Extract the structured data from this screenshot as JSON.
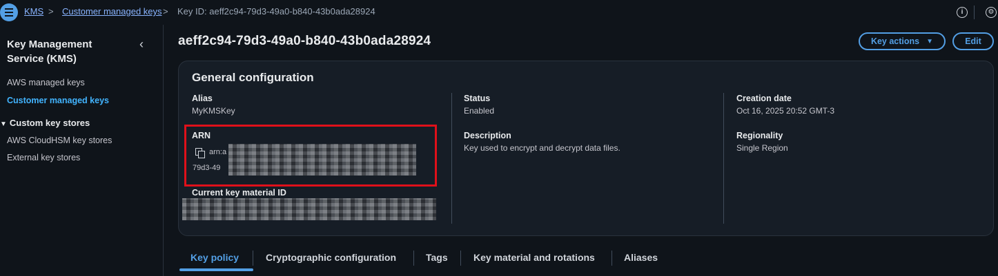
{
  "breadcrumb": {
    "home": "KMS",
    "section": "Customer managed keys",
    "current": "Key ID: aeff2c94-79d3-49a0-b840-43b0ada28924",
    "separator": ">"
  },
  "top_icons": {
    "info": "i",
    "settings": "⚙"
  },
  "sidebar": {
    "title": "Key Management Service (KMS)",
    "collapse_icon": "‹",
    "items": [
      {
        "label": "AWS managed keys"
      },
      {
        "label": "Customer managed keys"
      }
    ],
    "section": {
      "label": "Custom key stores",
      "caret": "▼"
    },
    "section_items": [
      {
        "label": "AWS CloudHSM key stores"
      },
      {
        "label": "External key stores"
      }
    ]
  },
  "page": {
    "title": "aeff2c94-79d3-49a0-b840-43b0ada28924",
    "key_actions_label": "Key actions",
    "key_actions_caret": "▼",
    "edit_label": "Edit"
  },
  "general_config": {
    "title": "General configuration",
    "alias_label": "Alias",
    "alias_value": "MyKMSKey",
    "arn_label": "ARN",
    "arn_prefix": "arn:a",
    "arn_line2_prefix": "79d3-49",
    "current_key_material_label": "Current key material ID",
    "status_label": "Status",
    "status_value": "Enabled",
    "description_label": "Description",
    "description_value": "Key used to encrypt and decrypt data files.",
    "creation_label": "Creation date",
    "creation_value": "Oct 16, 2025 20:52 GMT-3",
    "regionality_label": "Regionality",
    "regionality_value": "Single Region"
  },
  "tabs": [
    {
      "label": "Key policy"
    },
    {
      "label": "Cryptographic configuration"
    },
    {
      "label": "Tags"
    },
    {
      "label": "Key material and rotations"
    },
    {
      "label": "Aliases"
    }
  ],
  "colors": {
    "accent": "#539fe5",
    "highlight": "#e0101a",
    "background": "#0f141a"
  }
}
